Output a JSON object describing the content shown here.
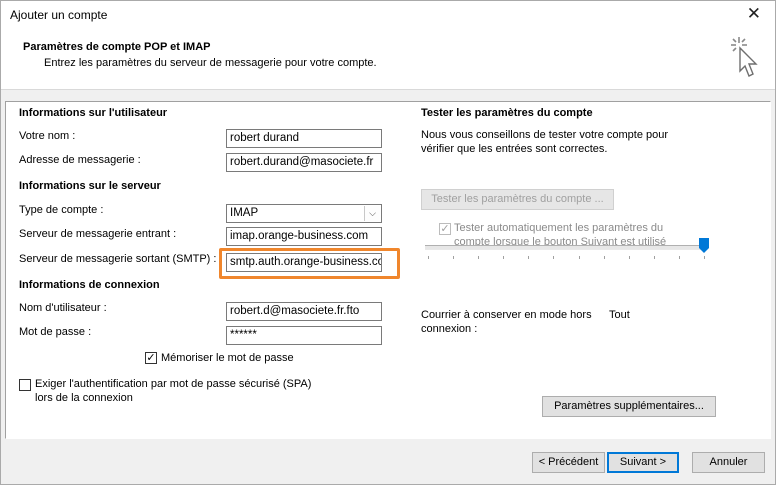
{
  "window": {
    "title": "Ajouter un compte",
    "close_glyph": "✕"
  },
  "header": {
    "title": "Paramètres de compte POP et IMAP",
    "subtitle": "Entrez les paramètres du serveur de messagerie pour votre compte.",
    "icon": "cursor-click-icon"
  },
  "user_info": {
    "section_title": "Informations sur l'utilisateur",
    "name_label": "Votre nom :",
    "name_value": "robert durand",
    "email_label": "Adresse de messagerie :",
    "email_value": "robert.durand@masociete.fr"
  },
  "server_info": {
    "section_title": "Informations sur le serveur",
    "account_type_label": "Type de compte :",
    "account_type_value": "IMAP",
    "incoming_label": "Serveur de messagerie entrant :",
    "incoming_value": "imap.orange-business.com",
    "outgoing_label": "Serveur de messagerie sortant (SMTP) :",
    "outgoing_value": "smtp.auth.orange-business.co"
  },
  "login_info": {
    "section_title": "Informations de connexion",
    "username_label": "Nom d'utilisateur :",
    "username_value": "robert.d@masociete.fr.fto",
    "password_label": "Mot de passe :",
    "password_value": "******",
    "remember_label": "Mémoriser le mot de passe",
    "remember_checked": true,
    "spa_label_line1": "Exiger l'authentification par mot de passe sécurisé (SPA)",
    "spa_label_line2": "lors de la connexion",
    "spa_checked": false
  },
  "test": {
    "section_title": "Tester les paramètres du compte",
    "description_line1": "Nous vous conseillons de tester votre compte pour",
    "description_line2": "vérifier que les entrées sont correctes.",
    "test_button": "Tester les paramètres du compte ...",
    "auto_test_line1": "Tester automatiquement les paramètres du",
    "auto_test_line2": "compte lorsque le bouton Suivant est utilisé",
    "auto_test_checked": true
  },
  "offline": {
    "label_line1": "Courrier à conserver en mode hors",
    "label_line2": "connexion :",
    "value_label": "Tout",
    "slider_fraction": 1.0
  },
  "more_settings_button": "Paramètres supplémentaires...",
  "footer": {
    "back_button": "< Précédent",
    "next_button": "Suivant >",
    "cancel_button": "Annuler"
  },
  "colors": {
    "highlight": "#f0862c",
    "accent": "#0078d7"
  }
}
